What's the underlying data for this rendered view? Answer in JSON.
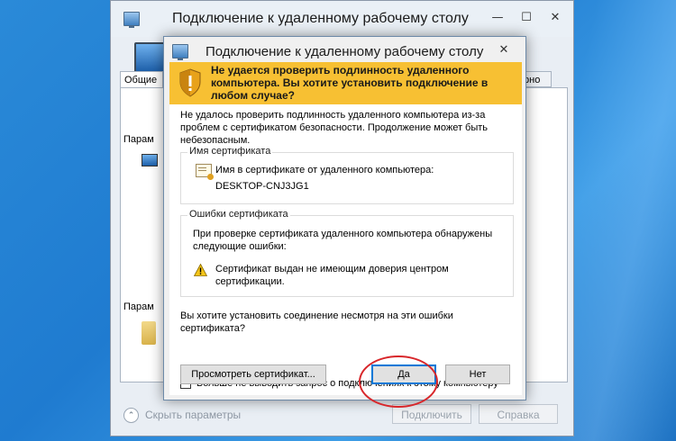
{
  "back_window": {
    "title": "Подключение к удаленному рабочему столу",
    "tab_general": "Общие",
    "tab_right_partial": "рно",
    "group1_label": "Парам",
    "group2_label": "Парам",
    "hide_params": "Скрыть параметры",
    "connect_label": "Подключить",
    "help_label": "Справка"
  },
  "dialog": {
    "title": "Подключение к удаленному рабочему столу",
    "close_glyph": "✕",
    "banner": "Не удается проверить подлинность удаленного компьютера. Вы хотите установить подключение в любом случае?",
    "intro": "Не удалось проверить подлинность удаленного компьютера из-за проблем с сертификатом безопасности. Продолжение может быть небезопасным.",
    "cert_group": {
      "label": "Имя сертификата",
      "caption": "Имя в сертификате от удаленного компьютера:",
      "name": "DESKTOP-CNJ3JG1"
    },
    "errors_group": {
      "label": "Ошибки сертификата",
      "intro": "При проверке сертификата удаленного компьютера обнаружены следующие ошибки:",
      "error": "Сертификат выдан не имеющим доверия центром сертификации."
    },
    "question": "Вы хотите установить соединение несмотря на эти ошибки сертификата?",
    "checkbox_label": "Больше не выводить запрос о подключениях к этому компьютеру",
    "checkbox_checked": false,
    "view_cert_button": "Просмотреть сертификат...",
    "yes_button": "Да",
    "no_button": "Нет"
  },
  "icons": {
    "minimize": "—",
    "maximize": "☐",
    "close": "✕",
    "chevron_up": "⌃"
  },
  "colors": {
    "banner": "#f7c033",
    "highlight_ellipse": "#d8262a",
    "desktop_blue": "#1f7bd0"
  }
}
